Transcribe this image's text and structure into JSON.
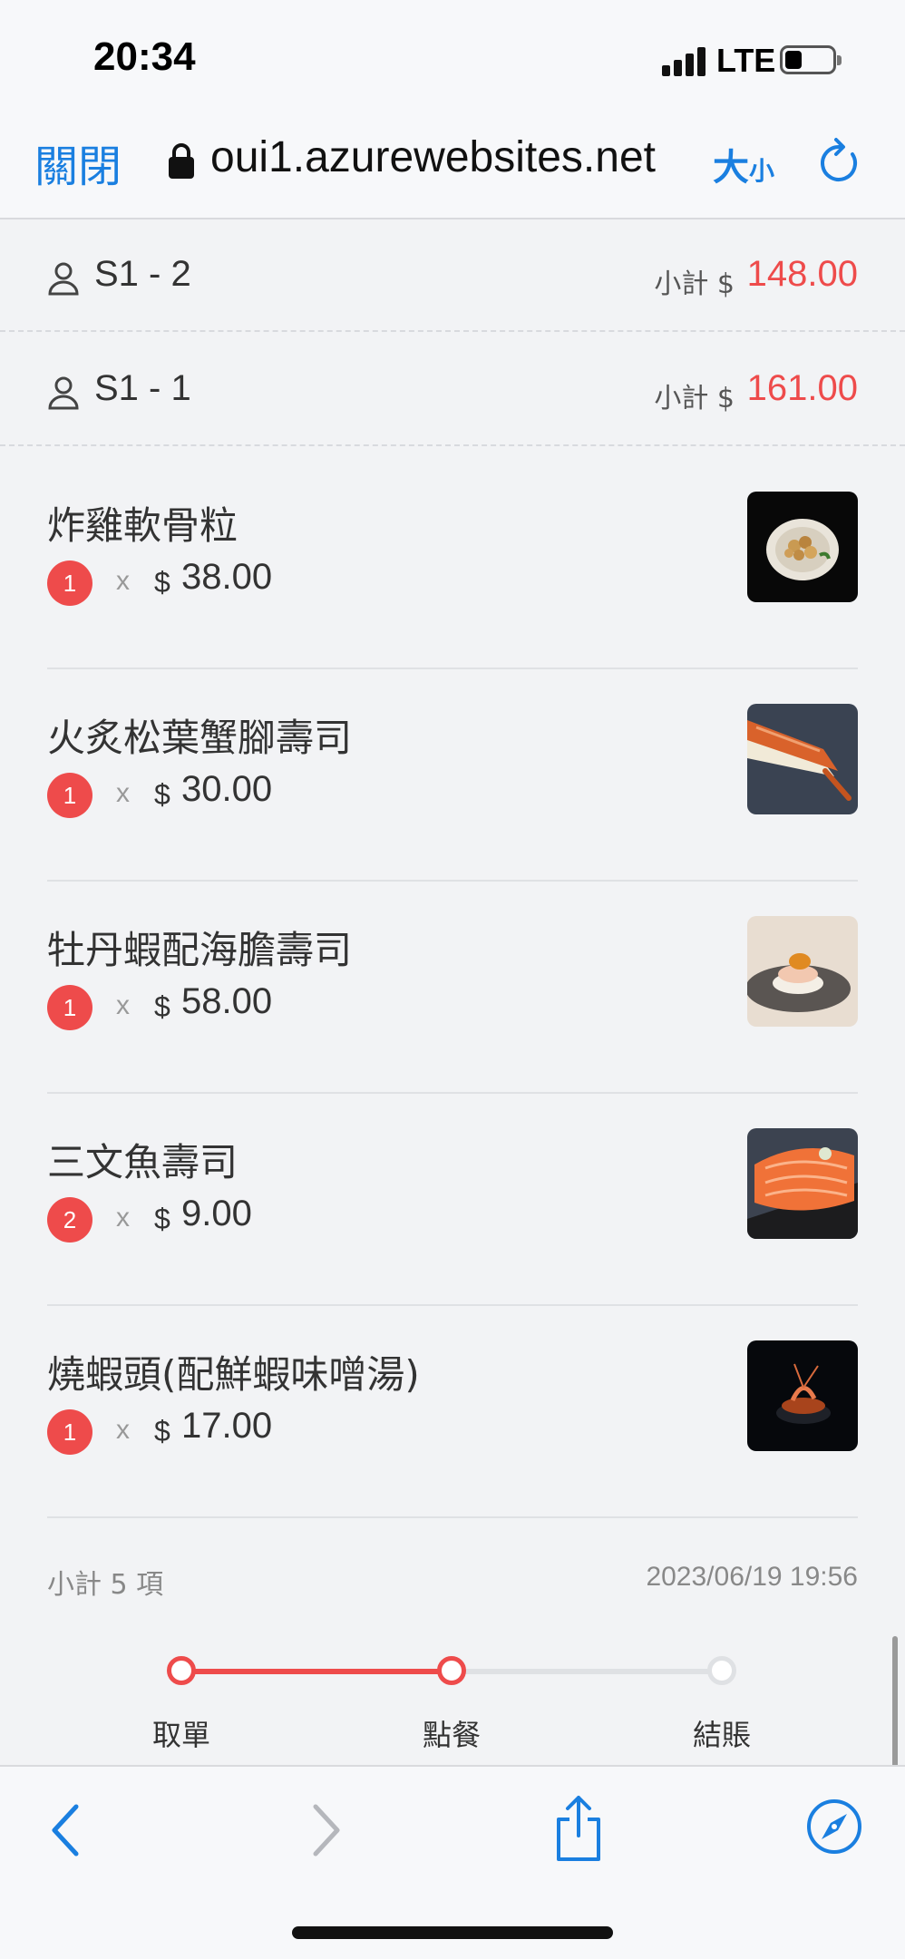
{
  "status_bar": {
    "time": "20:34",
    "network": "LTE"
  },
  "browser": {
    "close_label": "關閉",
    "url": "oui1.azurewebsites.net",
    "size_label_big": "大",
    "size_label_small": "小"
  },
  "seats": [
    {
      "name": "S1 - 2",
      "subtotal_label": "小計 $",
      "subtotal": "148.00"
    },
    {
      "name": "S1 - 1",
      "subtotal_label": "小計 $",
      "subtotal": "161.00"
    }
  ],
  "items": [
    {
      "name": "炸雞軟骨粒",
      "qty": "1",
      "times": "x",
      "currency": "$",
      "price": "38.00",
      "image_icon": "fried-chicken-cartilage-photo"
    },
    {
      "name": "火炙松葉蟹腳壽司",
      "qty": "1",
      "times": "x",
      "currency": "$",
      "price": "30.00",
      "image_icon": "crab-leg-sushi-photo"
    },
    {
      "name": "牡丹蝦配海膽壽司",
      "qty": "1",
      "times": "x",
      "currency": "$",
      "price": "58.00",
      "image_icon": "botan-shrimp-uni-sushi-photo"
    },
    {
      "name": "三文魚壽司",
      "qty": "2",
      "times": "x",
      "currency": "$",
      "price": "9.00",
      "image_icon": "salmon-sushi-photo"
    },
    {
      "name": "燒蝦頭(配鮮蝦味噌湯)",
      "qty": "1",
      "times": "x",
      "currency": "$",
      "price": "17.00",
      "image_icon": "grilled-shrimp-head-photo"
    }
  ],
  "summary": {
    "count_text": "小計 5 項",
    "timestamp": "2023/06/19 19:56"
  },
  "progress": {
    "steps": [
      {
        "label": "取單",
        "done": true
      },
      {
        "label": "點餐",
        "done": true
      },
      {
        "label": "結賬",
        "done": false
      }
    ],
    "fraction_complete": 0.5
  },
  "colors": {
    "accent": "#ee4b4b",
    "link": "#1a7fe0"
  }
}
